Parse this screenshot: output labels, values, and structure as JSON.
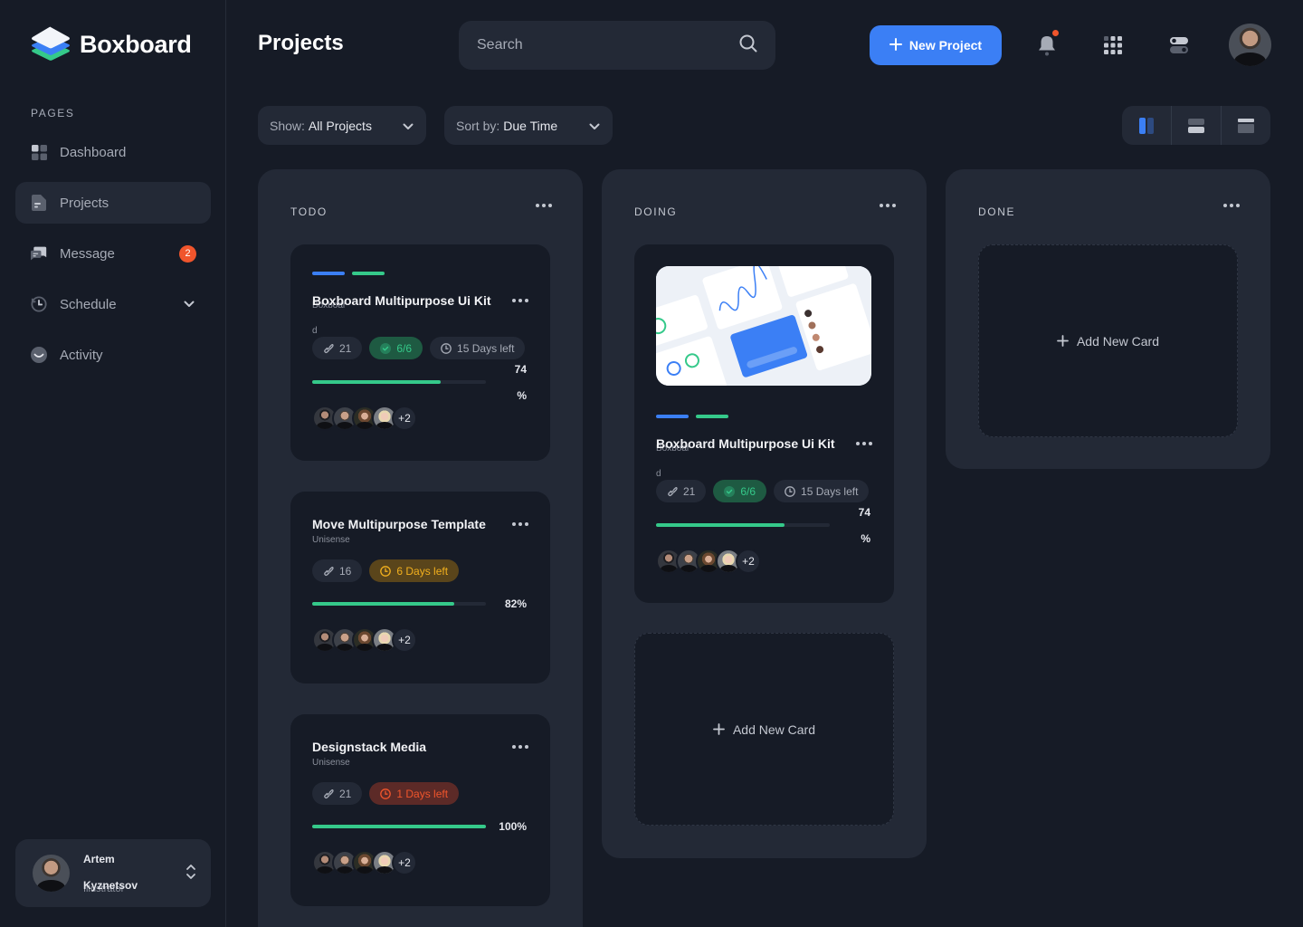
{
  "brand": {
    "name": "Boxboard"
  },
  "sidebar": {
    "section_label": "PAGES",
    "items": [
      {
        "label": "Dashboard",
        "icon": "dashboard-icon"
      },
      {
        "label": "Projects",
        "icon": "document-icon",
        "active": true
      },
      {
        "label": "Message",
        "icon": "message-icon",
        "badge": "2"
      },
      {
        "label": "Schedule",
        "icon": "clock-history-icon",
        "has_submenu": true
      },
      {
        "label": "Activity",
        "icon": "activity-icon"
      }
    ],
    "user": {
      "first_name": "Artem",
      "last_name": "Kyznetsov",
      "role": "Illustrator"
    }
  },
  "header": {
    "title": "Projects",
    "search_placeholder": "Search",
    "new_project_label": "New Project",
    "notifications_unread": true
  },
  "filters": {
    "show": {
      "label": "Show:",
      "value": "All Projects"
    },
    "sort": {
      "label": "Sort by:",
      "value": "Due Time"
    },
    "view_modes": [
      "columns",
      "rows",
      "list"
    ],
    "active_view": "columns"
  },
  "colors": {
    "accent": "#3b7ff5",
    "success": "#35c98a",
    "warning": "#f2b01e",
    "danger": "#f0552c",
    "background": "#161b26",
    "surface": "#232936"
  },
  "board": {
    "columns": [
      {
        "title": "TODO",
        "cards": [
          {
            "title": "Boxboard Multipurpose Ui Kit",
            "subtitle": "Boxboar",
            "subtitle_wrap": "d",
            "tags": [
              "#3b7ff5",
              "#35c98a"
            ],
            "links": "21",
            "tasks": "6/6",
            "due": "15 Days left",
            "due_status": "neutral",
            "progress_pct": 74,
            "progress_value": "74",
            "progress_unit": "%",
            "extra_members": "+2"
          },
          {
            "title": "Move Multipurpose Template",
            "subtitle": "Unisense",
            "links": "16",
            "due": "6 Days left",
            "due_status": "warning",
            "progress_pct": 82,
            "progress_label": "82%",
            "extra_members": "+2"
          },
          {
            "title": "Designstack Media",
            "subtitle": "Unisense",
            "links": "21",
            "due": "1 Days left",
            "due_status": "danger",
            "progress_pct": 100,
            "progress_label": "100%",
            "extra_members": "+2"
          }
        ]
      },
      {
        "title": "DOING",
        "cards": [
          {
            "has_preview": true,
            "title": "Boxboard Multipurpose Ui Kit",
            "subtitle": "Boxboar",
            "subtitle_wrap": "d",
            "tags": [
              "#3b7ff5",
              "#35c98a"
            ],
            "links": "21",
            "tasks": "6/6",
            "due": "15 Days left",
            "due_status": "neutral",
            "progress_pct": 74,
            "progress_value": "74",
            "progress_unit": "%",
            "extra_members": "+2"
          }
        ],
        "add_card_label": "Add New Card"
      },
      {
        "title": "DONE",
        "cards": [],
        "add_card_label": "Add New Card"
      }
    ]
  }
}
